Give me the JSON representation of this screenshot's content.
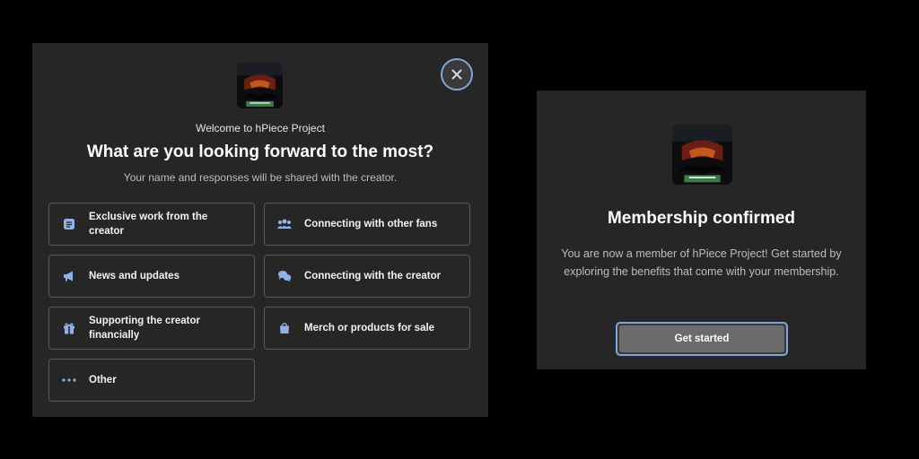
{
  "colors": {
    "background": "#000000",
    "panel": "#262626",
    "border": "#5a5a5a",
    "accent": "#7fa6d8",
    "icon": "#8fb3e6",
    "button_fill": "#6b6b6b"
  },
  "survey_modal": {
    "close_icon": "close-icon",
    "welcome": "Welcome to hPiece Project",
    "headline": "What are you looking forward to the most?",
    "subtext": "Your name and responses will be shared with the creator.",
    "options": [
      {
        "label": "Exclusive work from the creator",
        "icon": "document-icon"
      },
      {
        "label": "Connecting with other fans",
        "icon": "people-icon"
      },
      {
        "label": "News and updates",
        "icon": "megaphone-icon"
      },
      {
        "label": "Connecting with the creator",
        "icon": "chat-bubbles-icon"
      },
      {
        "label": "Supporting the creator financially",
        "icon": "gift-icon"
      },
      {
        "label": "Merch or products for sale",
        "icon": "shopping-bag-icon"
      },
      {
        "label": "Other",
        "icon": "ellipsis-icon"
      }
    ]
  },
  "confirmation_modal": {
    "title": "Membership confirmed",
    "body": "You are now a member of hPiece Project! Get started by exploring the benefits that come with your membership.",
    "button_label": "Get started"
  }
}
